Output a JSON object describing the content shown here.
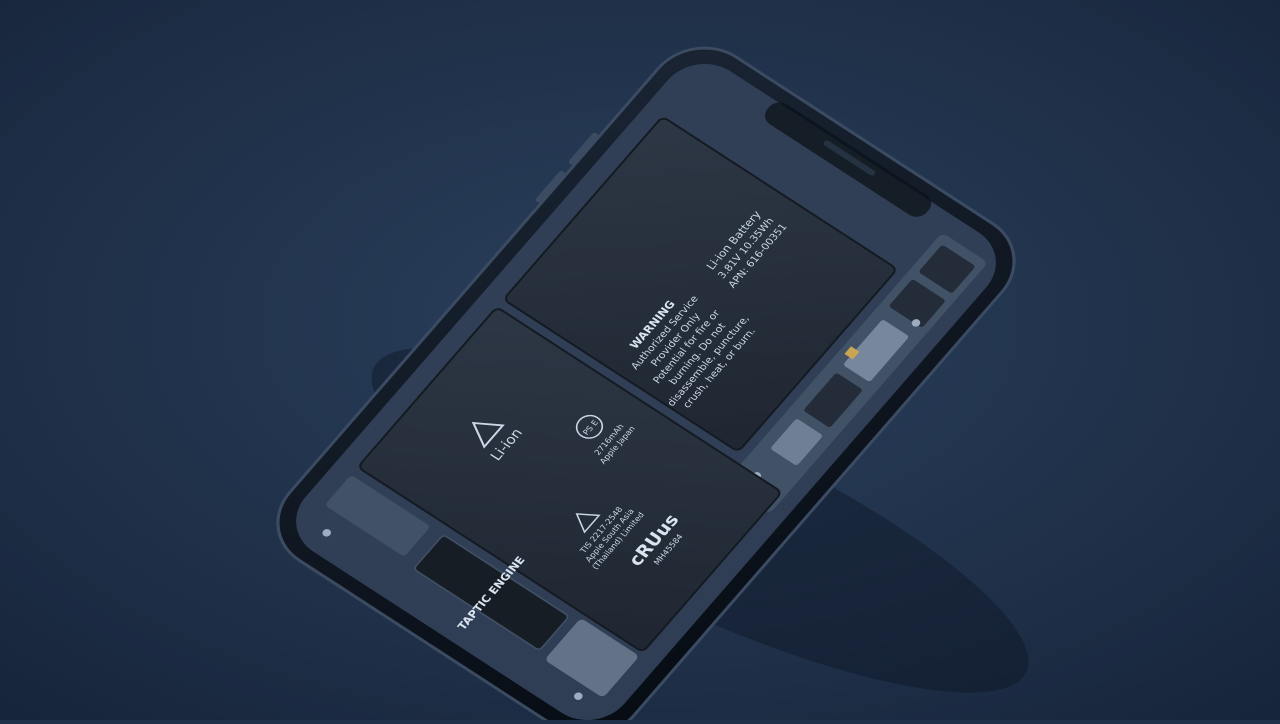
{
  "colors": {
    "background": "#1f3048",
    "phone_frame": "#0c141f",
    "battery": "#1c2431",
    "component_grey": "#8a9bb1",
    "label_text": "#c9d6e6"
  },
  "battery_top": {
    "title": "Li-ion Battery",
    "rating": "3.81V  10.35Wh",
    "apn": "APN: 616-00351",
    "warning_label": "WARNING",
    "warning_line1": "Authorized Service",
    "warning_line2": "Provider Only",
    "warning_line3": "Potential for fire or",
    "warning_line4": "burning. Do not",
    "warning_line5": "disassemble, puncture,",
    "warning_line6": "crush, heat, or burn."
  },
  "battery_bottom": {
    "recycle_label": "Li-ion",
    "cert_line1": "TIS 2217-2548",
    "cert_line2": "Apple South Asia",
    "cert_line3": "(Thailand) Limited",
    "ul_mark": "cRUus",
    "ul_code": "MH45584",
    "pse_mark": "PS E",
    "capacity": "2716mAh",
    "maker": "Apple Japan"
  },
  "taptic": {
    "label": "TAPTIC ENGINE",
    "logo_glyph": ""
  }
}
